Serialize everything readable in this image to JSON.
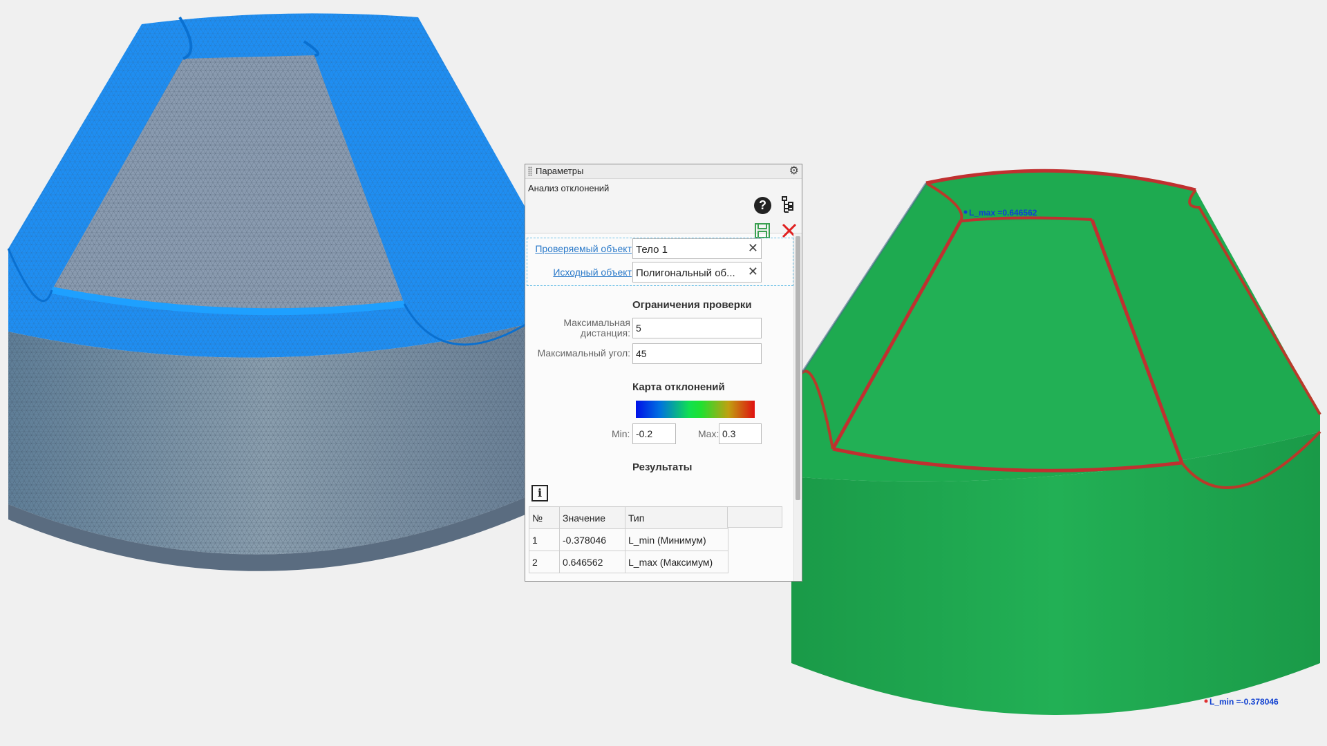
{
  "panel": {
    "title": "Параметры",
    "operation_name": "Анализ отклонений",
    "objects": {
      "checked_label": "Проверяемый объект",
      "checked_value": "Тело 1",
      "source_label": "Исходный объект",
      "source_value": "Полигональный об..."
    },
    "limits": {
      "title": "Ограничения проверки",
      "max_distance_label_line1": "Максимальная",
      "max_distance_label_line2": "дистанция:",
      "max_distance_value": "5",
      "max_angle_label": "Максимальный угол:",
      "max_angle_value": "45"
    },
    "deviation_map": {
      "title": "Карта отклонений",
      "min_label": "Min:",
      "min_value": "-0.2",
      "max_label": "Max:",
      "max_value": "0.3",
      "colors": [
        "#0010e8",
        "#10e050",
        "#e01010"
      ]
    },
    "results": {
      "title": "Результаты",
      "columns": [
        "№",
        "Значение",
        "Тип"
      ],
      "rows": [
        {
          "n": "1",
          "value": "-0.378046",
          "type": "L_min (Минимум)"
        },
        {
          "n": "2",
          "value": "0.646562",
          "type": "L_max (Максимум)"
        }
      ]
    }
  },
  "viewport": {
    "mesh_color": "#1e90ff",
    "deviation_base_color": "#18a850",
    "marker_max": "L_max =0.646562",
    "marker_min": "L_min =-0.378046"
  }
}
